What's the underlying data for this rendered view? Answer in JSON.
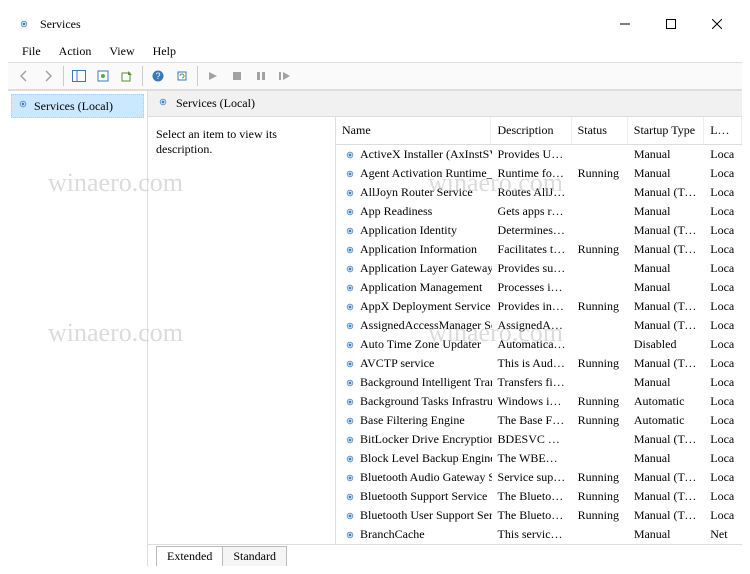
{
  "title": "Services",
  "menus": {
    "file": "File",
    "action": "Action",
    "view": "View",
    "help": "Help"
  },
  "tree": {
    "root": "Services (Local)"
  },
  "details": {
    "heading": "Services (Local)",
    "hint": "Select an item to view its description."
  },
  "columns": {
    "name": "Name",
    "desc": "Description",
    "status": "Status",
    "startup": "Startup Type",
    "logon": "Log On As"
  },
  "rows": [
    {
      "name": "ActiveX Installer (AxInstSV)",
      "desc": "Provides Us…",
      "status": "",
      "startup": "Manual",
      "logon": "Loca"
    },
    {
      "name": "Agent Activation Runtime_…",
      "desc": "Runtime for…",
      "status": "Running",
      "startup": "Manual",
      "logon": "Loca"
    },
    {
      "name": "AllJoyn Router Service",
      "desc": "Routes AllJo…",
      "status": "",
      "startup": "Manual (Trig…",
      "logon": "Loca"
    },
    {
      "name": "App Readiness",
      "desc": "Gets apps re…",
      "status": "",
      "startup": "Manual",
      "logon": "Loca"
    },
    {
      "name": "Application Identity",
      "desc": "Determines …",
      "status": "",
      "startup": "Manual (Trig…",
      "logon": "Loca"
    },
    {
      "name": "Application Information",
      "desc": "Facilitates t…",
      "status": "Running",
      "startup": "Manual (Trig…",
      "logon": "Loca"
    },
    {
      "name": "Application Layer Gateway …",
      "desc": "Provides su…",
      "status": "",
      "startup": "Manual",
      "logon": "Loca"
    },
    {
      "name": "Application Management",
      "desc": "Processes in…",
      "status": "",
      "startup": "Manual",
      "logon": "Loca"
    },
    {
      "name": "AppX Deployment Service (…",
      "desc": "Provides inf…",
      "status": "Running",
      "startup": "Manual (Trig…",
      "logon": "Loca"
    },
    {
      "name": "AssignedAccessManager Se…",
      "desc": "AssignedAc…",
      "status": "",
      "startup": "Manual (Trig…",
      "logon": "Loca"
    },
    {
      "name": "Auto Time Zone Updater",
      "desc": "Automatica…",
      "status": "",
      "startup": "Disabled",
      "logon": "Loca"
    },
    {
      "name": "AVCTP service",
      "desc": "This is Audi…",
      "status": "Running",
      "startup": "Manual (Trig…",
      "logon": "Loca"
    },
    {
      "name": "Background Intelligent Tran…",
      "desc": "Transfers fil…",
      "status": "",
      "startup": "Manual",
      "logon": "Loca"
    },
    {
      "name": "Background Tasks Infrastruc…",
      "desc": "Windows in…",
      "status": "Running",
      "startup": "Automatic",
      "logon": "Loca"
    },
    {
      "name": "Base Filtering Engine",
      "desc": "The Base Fil…",
      "status": "Running",
      "startup": "Automatic",
      "logon": "Loca"
    },
    {
      "name": "BitLocker Drive Encryption …",
      "desc": "BDESVC hos…",
      "status": "",
      "startup": "Manual (Trig…",
      "logon": "Loca"
    },
    {
      "name": "Block Level Backup Engine …",
      "desc": "The WBENG…",
      "status": "",
      "startup": "Manual",
      "logon": "Loca"
    },
    {
      "name": "Bluetooth Audio Gateway S…",
      "desc": "Service sup…",
      "status": "Running",
      "startup": "Manual (Trig…",
      "logon": "Loca"
    },
    {
      "name": "Bluetooth Support Service",
      "desc": "The Bluetoo…",
      "status": "Running",
      "startup": "Manual (Trig…",
      "logon": "Loca"
    },
    {
      "name": "Bluetooth User Support Ser…",
      "desc": "The Bluetoo…",
      "status": "Running",
      "startup": "Manual (Trig…",
      "logon": "Loca"
    },
    {
      "name": "BranchCache",
      "desc": "This service …",
      "status": "",
      "startup": "Manual",
      "logon": "Net"
    }
  ],
  "tabs": {
    "extended": "Extended",
    "standard": "Standard"
  },
  "watermark": "winaero.com"
}
